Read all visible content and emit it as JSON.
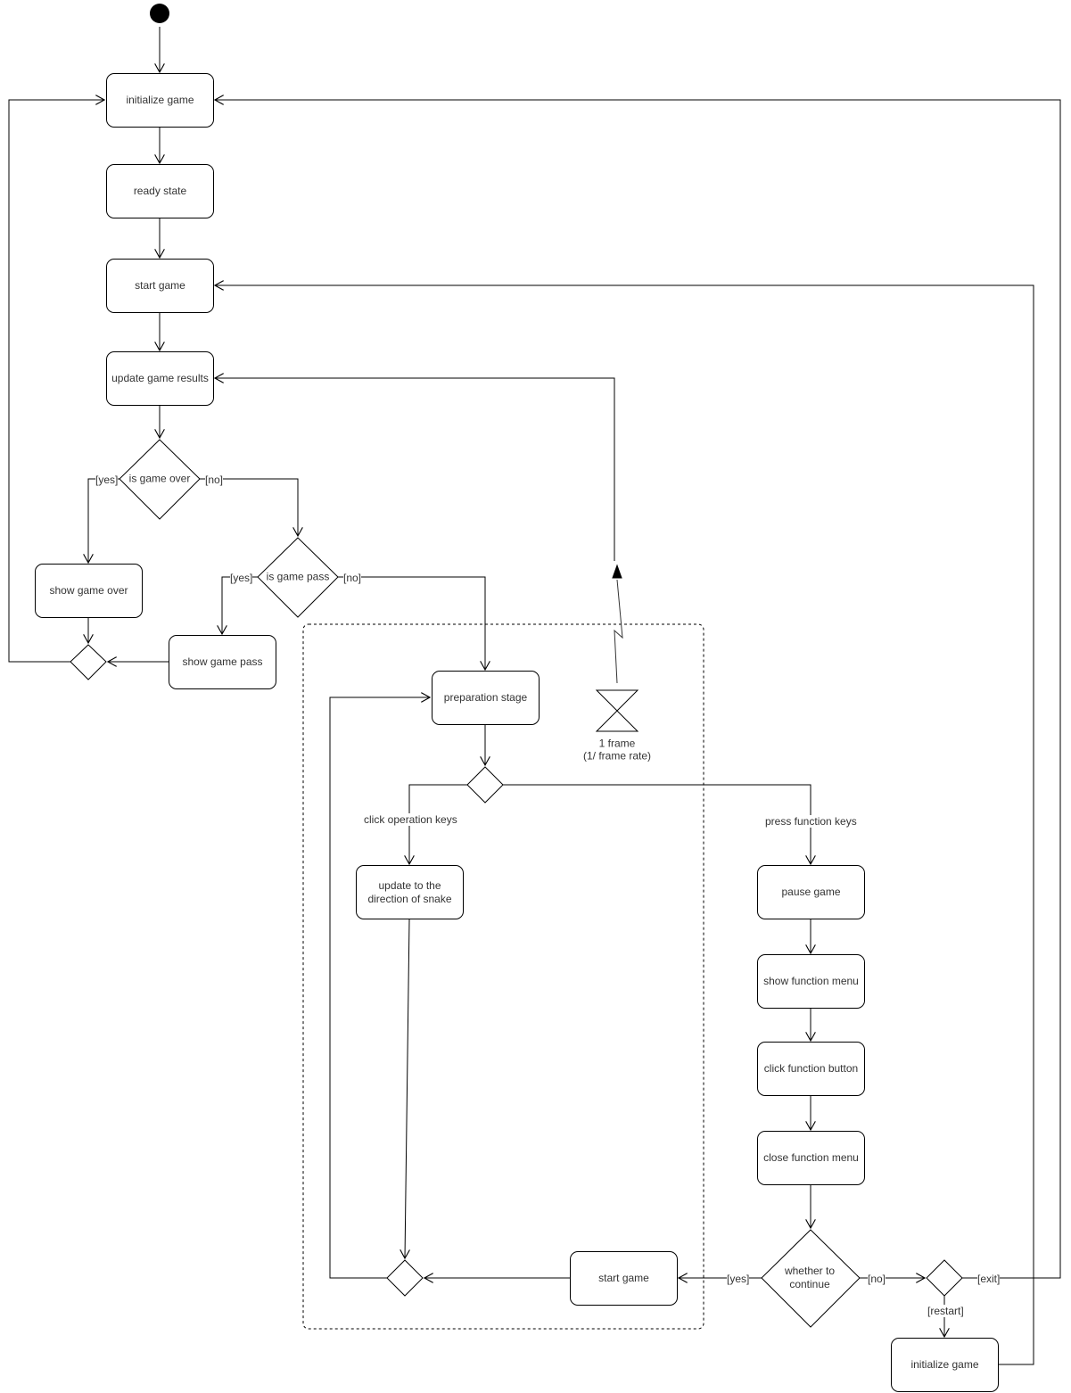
{
  "diagram": {
    "type": "UML activity diagram",
    "subject": "snake game flow"
  },
  "nodes": {
    "initialize_game_top": "initialize game",
    "ready_state": "ready state",
    "start_game_top": "start game",
    "update_game_results": "update game results",
    "show_game_over": "show game over",
    "show_game_pass": "show game pass",
    "preparation_stage": "preparation stage",
    "update_direction": "update to the direction of snake",
    "pause_game": "pause game",
    "show_function_menu": "show function menu",
    "click_function_button": "click function button",
    "close_function_menu": "close function menu",
    "start_game_bottom": "start game",
    "initialize_game_bottom": "initialize game"
  },
  "decisions": {
    "is_game_over": "is game over",
    "is_game_pass": "is game pass",
    "whether_to_continue": "whether to continue"
  },
  "guards": {
    "over_yes": "[yes]",
    "over_no": "[no]",
    "pass_yes": "[yes]",
    "pass_no": "[no]",
    "continue_yes": "[yes]",
    "continue_no": "[no]",
    "exit": "[exit]",
    "restart": "[restart]"
  },
  "edge_labels": {
    "click_operation_keys": "click operation keys",
    "press_function_keys": "press function keys"
  },
  "time_event": {
    "line1": "1 frame",
    "line2": "(1/ frame rate)"
  }
}
